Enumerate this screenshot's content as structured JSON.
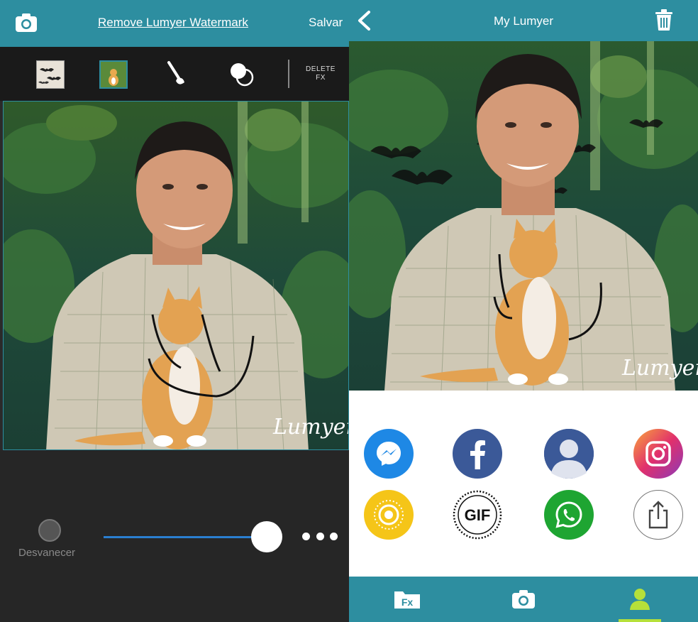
{
  "left": {
    "header": {
      "remove_watermark_label": "Remove Lumyer Watermark",
      "save_label": "Salvar"
    },
    "fx_bar": {
      "delete_fx_line1": "DELETE",
      "delete_fx_line2": "FX"
    },
    "controls": {
      "fade_label": "Desvanecer",
      "slider_value_fraction": 0.96
    },
    "photo": {
      "watermark": "Lumyer"
    }
  },
  "right": {
    "header": {
      "title": "My Lumyer"
    },
    "photo": {
      "watermark": "Lumyer"
    },
    "share": {
      "items": [
        {
          "name": "messenger",
          "color": "#1e88e5"
        },
        {
          "name": "facebook",
          "color": "#3b5998"
        },
        {
          "name": "facebook-profile",
          "color": "#3b5998"
        },
        {
          "name": "instagram",
          "color": "#c13584"
        },
        {
          "name": "live-photo",
          "color": "#f5c518"
        },
        {
          "name": "gif",
          "label": "GIF",
          "color": "#ffffff"
        },
        {
          "name": "whatsapp",
          "color": "#1ea532"
        },
        {
          "name": "share-sheet",
          "color": "#ffffff"
        }
      ]
    },
    "tabs": {
      "fx_label": "Fx",
      "active": "profile"
    }
  },
  "colors": {
    "accent": "#2d8ea0",
    "active_tab": "#b5e03a",
    "slider": "#2a7fd1"
  }
}
